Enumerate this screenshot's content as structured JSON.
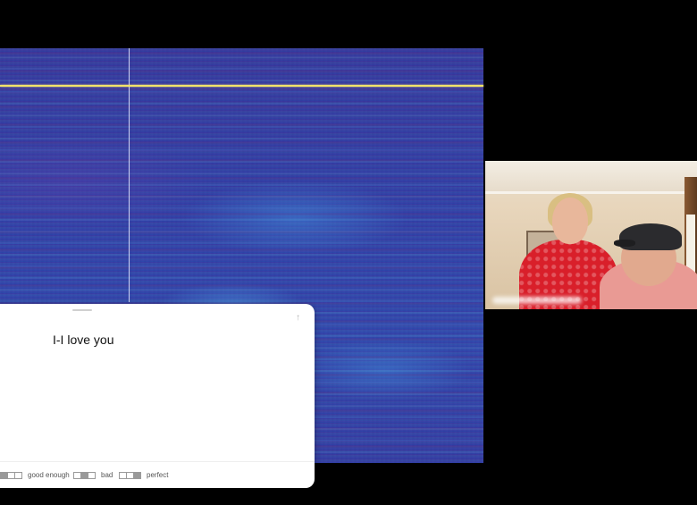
{
  "transcript": {
    "text": "I-I love you",
    "collapse_icon": "chevron-up-icon"
  },
  "rating": {
    "options": [
      {
        "label": "good enough",
        "icon": "rating-segments-icon"
      },
      {
        "label": "bad",
        "icon": "rating-segments-icon"
      },
      {
        "label": "perfect",
        "icon": "rating-segments-icon"
      }
    ]
  },
  "spectrogram": {
    "colors": {
      "low": "#3a2a8e",
      "high": "#4fb6f0",
      "marker": "#f2e26a"
    }
  },
  "video": {
    "people": [
      "woman in red floral shirt",
      "man in black cap and pink shirt"
    ]
  }
}
